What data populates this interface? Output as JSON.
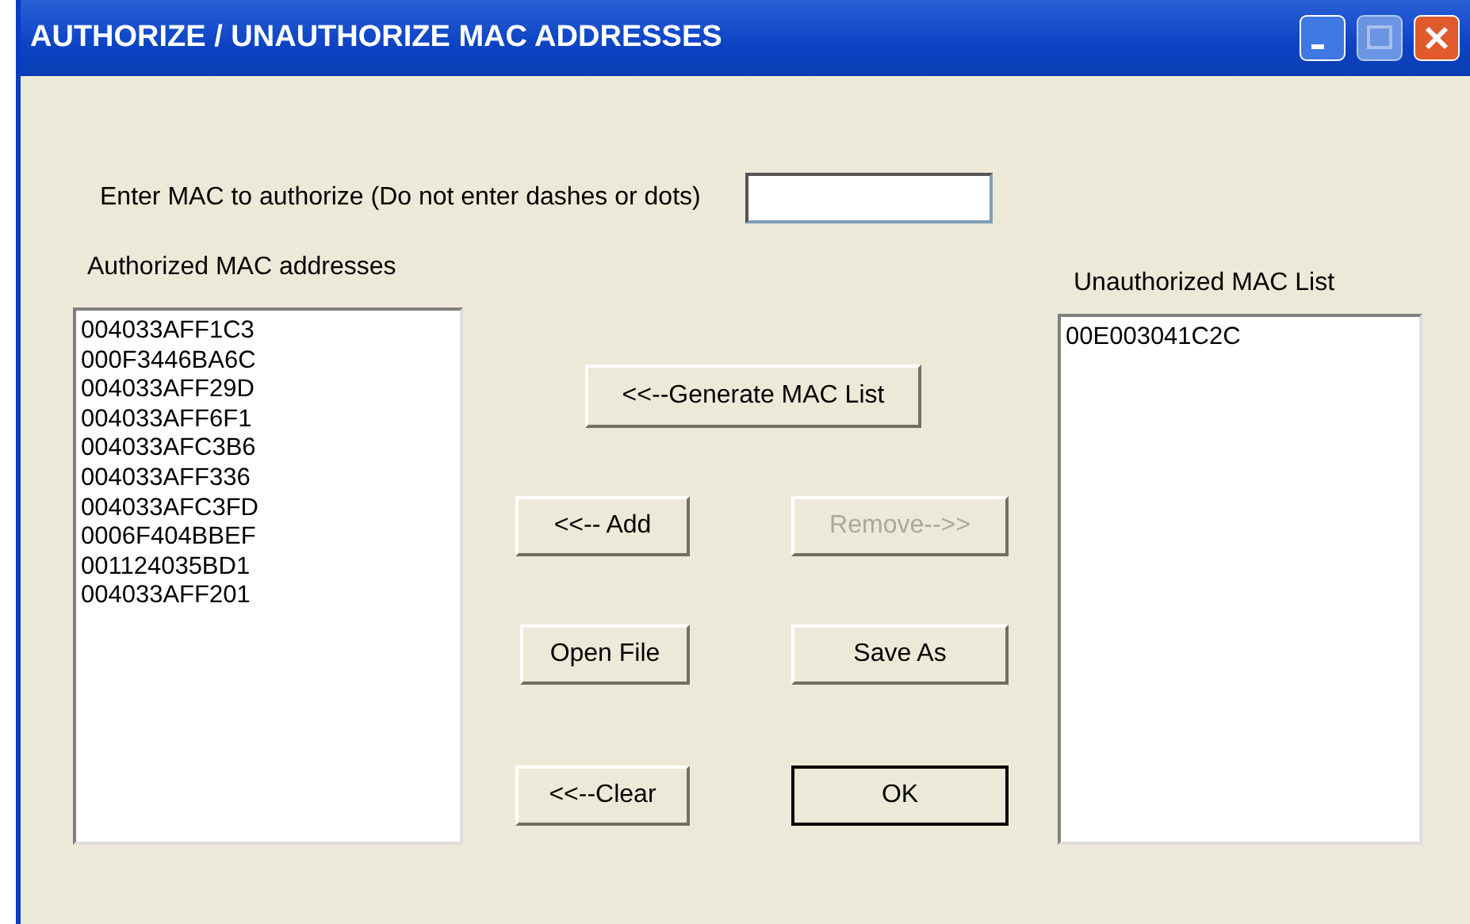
{
  "window": {
    "title": "AUTHORIZE / UNAUTHORIZE MAC ADDRESSES"
  },
  "mac_entry": {
    "label": "Enter MAC to authorize (Do not enter dashes or dots)"
  },
  "authorized": {
    "label": "Authorized MAC addresses",
    "items": [
      "004033AFF1C3",
      "000F3446BA6C",
      "004033AFF29D",
      "004033AFF6F1",
      "004033AFC3B6",
      "004033AFF336",
      "004033AFC3FD",
      "0006F404BBEF",
      "001124035BD1",
      "004033AFF201"
    ]
  },
  "unauthorized": {
    "label": "Unauthorized MAC List",
    "items": [
      "00E003041C2C"
    ]
  },
  "buttons": [
    {
      "label": "<<--Generate MAC List",
      "disabled": false,
      "default": false
    },
    {
      "label": "<<-- Add",
      "disabled": false,
      "default": false
    },
    {
      "label": "Remove-->>",
      "disabled": true,
      "default": false
    },
    {
      "label": "Open File",
      "disabled": false,
      "default": false
    },
    {
      "label": "Save As",
      "disabled": false,
      "default": false
    },
    {
      "label": "<<--Clear",
      "disabled": false,
      "default": false
    },
    {
      "label": "OK",
      "disabled": false,
      "default": true
    }
  ]
}
